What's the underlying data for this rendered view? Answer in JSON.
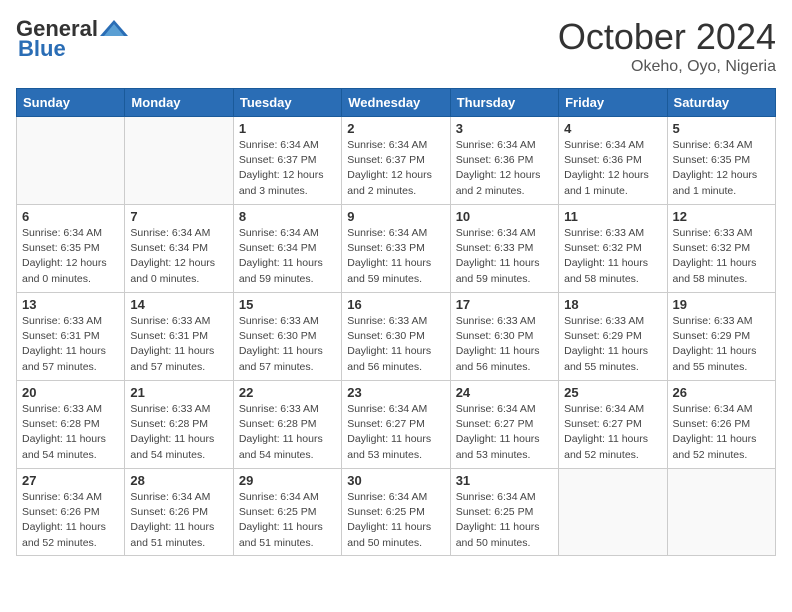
{
  "header": {
    "logo_general": "General",
    "logo_blue": "Blue",
    "month_title": "October 2024",
    "subtitle": "Okeho, Oyo, Nigeria"
  },
  "days_of_week": [
    "Sunday",
    "Monday",
    "Tuesday",
    "Wednesday",
    "Thursday",
    "Friday",
    "Saturday"
  ],
  "weeks": [
    [
      {
        "day": "",
        "detail": ""
      },
      {
        "day": "",
        "detail": ""
      },
      {
        "day": "1",
        "detail": "Sunrise: 6:34 AM\nSunset: 6:37 PM\nDaylight: 12 hours\nand 3 minutes."
      },
      {
        "day": "2",
        "detail": "Sunrise: 6:34 AM\nSunset: 6:37 PM\nDaylight: 12 hours\nand 2 minutes."
      },
      {
        "day": "3",
        "detail": "Sunrise: 6:34 AM\nSunset: 6:36 PM\nDaylight: 12 hours\nand 2 minutes."
      },
      {
        "day": "4",
        "detail": "Sunrise: 6:34 AM\nSunset: 6:36 PM\nDaylight: 12 hours\nand 1 minute."
      },
      {
        "day": "5",
        "detail": "Sunrise: 6:34 AM\nSunset: 6:35 PM\nDaylight: 12 hours\nand 1 minute."
      }
    ],
    [
      {
        "day": "6",
        "detail": "Sunrise: 6:34 AM\nSunset: 6:35 PM\nDaylight: 12 hours\nand 0 minutes."
      },
      {
        "day": "7",
        "detail": "Sunrise: 6:34 AM\nSunset: 6:34 PM\nDaylight: 12 hours\nand 0 minutes."
      },
      {
        "day": "8",
        "detail": "Sunrise: 6:34 AM\nSunset: 6:34 PM\nDaylight: 11 hours\nand 59 minutes."
      },
      {
        "day": "9",
        "detail": "Sunrise: 6:34 AM\nSunset: 6:33 PM\nDaylight: 11 hours\nand 59 minutes."
      },
      {
        "day": "10",
        "detail": "Sunrise: 6:34 AM\nSunset: 6:33 PM\nDaylight: 11 hours\nand 59 minutes."
      },
      {
        "day": "11",
        "detail": "Sunrise: 6:33 AM\nSunset: 6:32 PM\nDaylight: 11 hours\nand 58 minutes."
      },
      {
        "day": "12",
        "detail": "Sunrise: 6:33 AM\nSunset: 6:32 PM\nDaylight: 11 hours\nand 58 minutes."
      }
    ],
    [
      {
        "day": "13",
        "detail": "Sunrise: 6:33 AM\nSunset: 6:31 PM\nDaylight: 11 hours\nand 57 minutes."
      },
      {
        "day": "14",
        "detail": "Sunrise: 6:33 AM\nSunset: 6:31 PM\nDaylight: 11 hours\nand 57 minutes."
      },
      {
        "day": "15",
        "detail": "Sunrise: 6:33 AM\nSunset: 6:30 PM\nDaylight: 11 hours\nand 57 minutes."
      },
      {
        "day": "16",
        "detail": "Sunrise: 6:33 AM\nSunset: 6:30 PM\nDaylight: 11 hours\nand 56 minutes."
      },
      {
        "day": "17",
        "detail": "Sunrise: 6:33 AM\nSunset: 6:30 PM\nDaylight: 11 hours\nand 56 minutes."
      },
      {
        "day": "18",
        "detail": "Sunrise: 6:33 AM\nSunset: 6:29 PM\nDaylight: 11 hours\nand 55 minutes."
      },
      {
        "day": "19",
        "detail": "Sunrise: 6:33 AM\nSunset: 6:29 PM\nDaylight: 11 hours\nand 55 minutes."
      }
    ],
    [
      {
        "day": "20",
        "detail": "Sunrise: 6:33 AM\nSunset: 6:28 PM\nDaylight: 11 hours\nand 54 minutes."
      },
      {
        "day": "21",
        "detail": "Sunrise: 6:33 AM\nSunset: 6:28 PM\nDaylight: 11 hours\nand 54 minutes."
      },
      {
        "day": "22",
        "detail": "Sunrise: 6:33 AM\nSunset: 6:28 PM\nDaylight: 11 hours\nand 54 minutes."
      },
      {
        "day": "23",
        "detail": "Sunrise: 6:34 AM\nSunset: 6:27 PM\nDaylight: 11 hours\nand 53 minutes."
      },
      {
        "day": "24",
        "detail": "Sunrise: 6:34 AM\nSunset: 6:27 PM\nDaylight: 11 hours\nand 53 minutes."
      },
      {
        "day": "25",
        "detail": "Sunrise: 6:34 AM\nSunset: 6:27 PM\nDaylight: 11 hours\nand 52 minutes."
      },
      {
        "day": "26",
        "detail": "Sunrise: 6:34 AM\nSunset: 6:26 PM\nDaylight: 11 hours\nand 52 minutes."
      }
    ],
    [
      {
        "day": "27",
        "detail": "Sunrise: 6:34 AM\nSunset: 6:26 PM\nDaylight: 11 hours\nand 52 minutes."
      },
      {
        "day": "28",
        "detail": "Sunrise: 6:34 AM\nSunset: 6:26 PM\nDaylight: 11 hours\nand 51 minutes."
      },
      {
        "day": "29",
        "detail": "Sunrise: 6:34 AM\nSunset: 6:25 PM\nDaylight: 11 hours\nand 51 minutes."
      },
      {
        "day": "30",
        "detail": "Sunrise: 6:34 AM\nSunset: 6:25 PM\nDaylight: 11 hours\nand 50 minutes."
      },
      {
        "day": "31",
        "detail": "Sunrise: 6:34 AM\nSunset: 6:25 PM\nDaylight: 11 hours\nand 50 minutes."
      },
      {
        "day": "",
        "detail": ""
      },
      {
        "day": "",
        "detail": ""
      }
    ]
  ]
}
